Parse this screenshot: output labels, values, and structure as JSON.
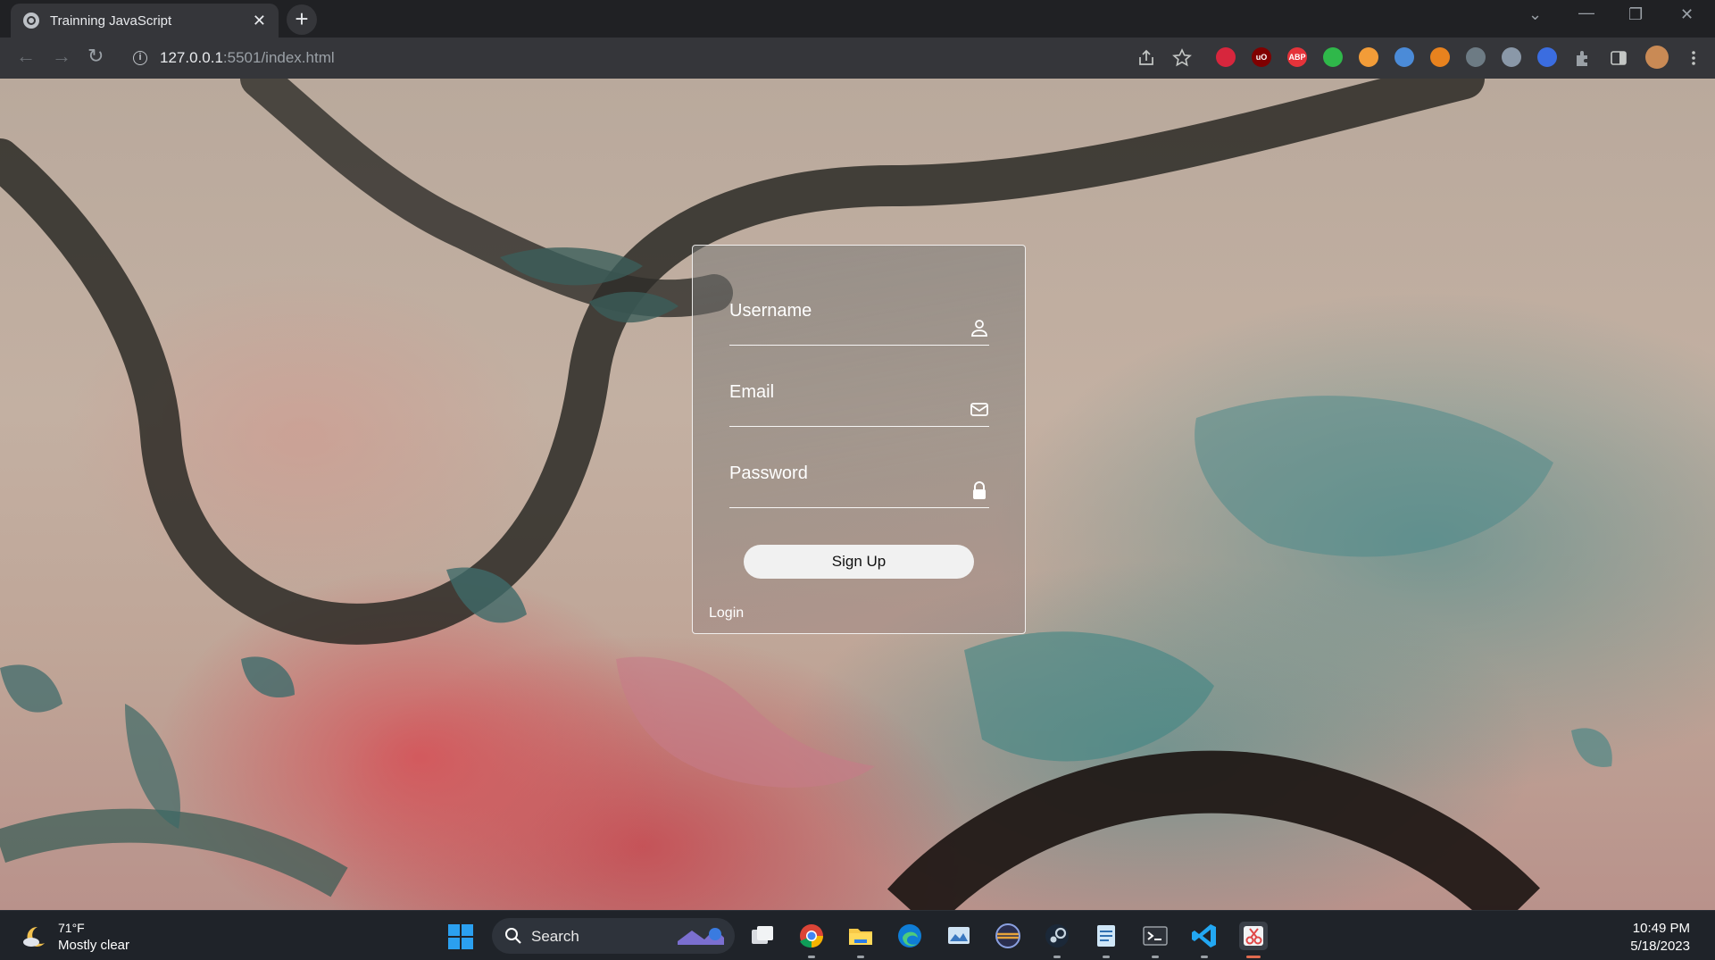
{
  "browser": {
    "tab_title": "Trainning JavaScript",
    "tab_close": "✕",
    "new_tab": "+",
    "url_host": "127.0.0.1",
    "url_rest": ":5501/index.html",
    "nav_back": "←",
    "nav_forward": "→",
    "nav_reload": "↻",
    "info_glyph": "i",
    "window_controls": {
      "chevron": "⌄",
      "minimize": "—",
      "restore": "❐",
      "close": "✕"
    },
    "extensions": [
      {
        "name": "block-icon",
        "label": "",
        "color": "#d7263d"
      },
      {
        "name": "ublock-icon",
        "label": "uO",
        "color": "#800000"
      },
      {
        "name": "adblock-plus-icon",
        "label": "ABP",
        "color": "#e5333a"
      },
      {
        "name": "shield-check-icon",
        "label": "",
        "color": "#2fb84a"
      },
      {
        "name": "egg-icon",
        "label": "",
        "color": "#f29c38"
      },
      {
        "name": "translate-icon",
        "label": "",
        "color": "#4b8bd8"
      },
      {
        "name": "metamask-icon",
        "label": "",
        "color": "#e8821e"
      },
      {
        "name": "ext-x-icon",
        "label": "",
        "color": "#6d7b84"
      },
      {
        "name": "shield-icon",
        "label": "",
        "color": "#8a98a8"
      },
      {
        "name": "wand-icon",
        "label": "",
        "color": "#3b6de0"
      }
    ]
  },
  "form": {
    "username_label": "Username",
    "email_label": "Email",
    "password_label": "Password",
    "signup_label": "Sign Up",
    "login_label": "Login"
  },
  "taskbar": {
    "weather_temp": "71°F",
    "weather_desc": "Mostly clear",
    "search_label": "Search",
    "time": "10:49 PM",
    "date": "5/18/2023",
    "apps": [
      "task-view-icon",
      "chrome-icon",
      "file-explorer-icon",
      "edge-icon",
      "monitor-app-icon",
      "sphere-app-icon",
      "steam-icon",
      "notepad-app-icon",
      "terminal-icon",
      "vscode-icon",
      "snipping-tool-icon"
    ]
  }
}
